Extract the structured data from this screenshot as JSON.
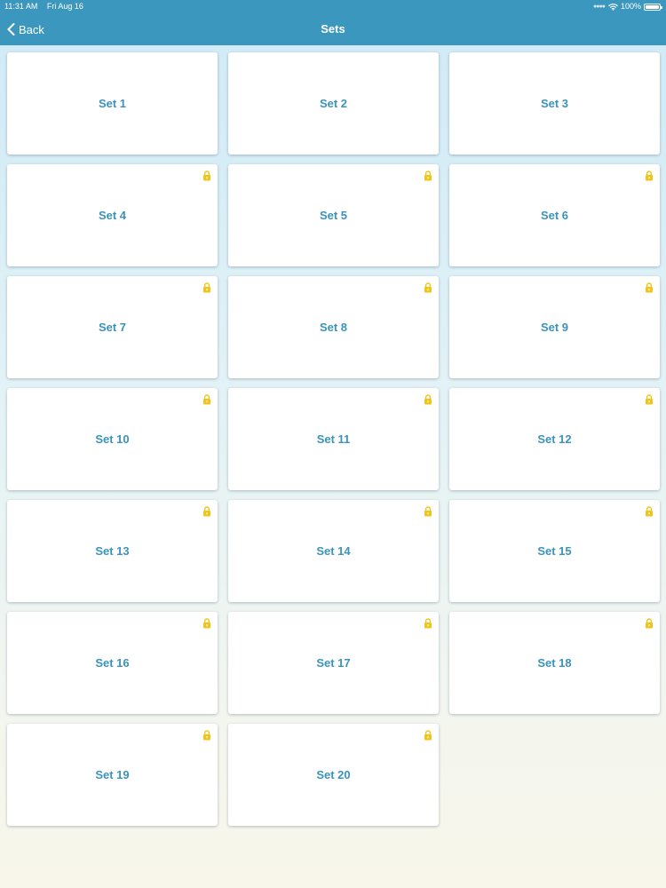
{
  "status_bar": {
    "time": "11:31 AM",
    "date": "Fri Aug 16",
    "battery": "100%",
    "battery_level": 1.0
  },
  "nav": {
    "back_label": "Back",
    "title": "Sets"
  },
  "colors": {
    "header": "#3b97bd",
    "label": "#3b93ba",
    "lock": "#f0c419"
  },
  "icons": {
    "back": "chevron-left-icon",
    "locked": "lock-icon",
    "wifi": "wifi-icon",
    "battery": "battery-icon"
  },
  "sets": [
    {
      "label": "Set 1",
      "locked": false
    },
    {
      "label": "Set 2",
      "locked": false
    },
    {
      "label": "Set 3",
      "locked": false
    },
    {
      "label": "Set 4",
      "locked": true
    },
    {
      "label": "Set 5",
      "locked": true
    },
    {
      "label": "Set 6",
      "locked": true
    },
    {
      "label": "Set 7",
      "locked": true
    },
    {
      "label": "Set 8",
      "locked": true
    },
    {
      "label": "Set 9",
      "locked": true
    },
    {
      "label": "Set 10",
      "locked": true
    },
    {
      "label": "Set 11",
      "locked": true
    },
    {
      "label": "Set 12",
      "locked": true
    },
    {
      "label": "Set 13",
      "locked": true
    },
    {
      "label": "Set 14",
      "locked": true
    },
    {
      "label": "Set 15",
      "locked": true
    },
    {
      "label": "Set 16",
      "locked": true
    },
    {
      "label": "Set 17",
      "locked": true
    },
    {
      "label": "Set 18",
      "locked": true
    },
    {
      "label": "Set 19",
      "locked": true
    },
    {
      "label": "Set 20",
      "locked": true
    }
  ]
}
